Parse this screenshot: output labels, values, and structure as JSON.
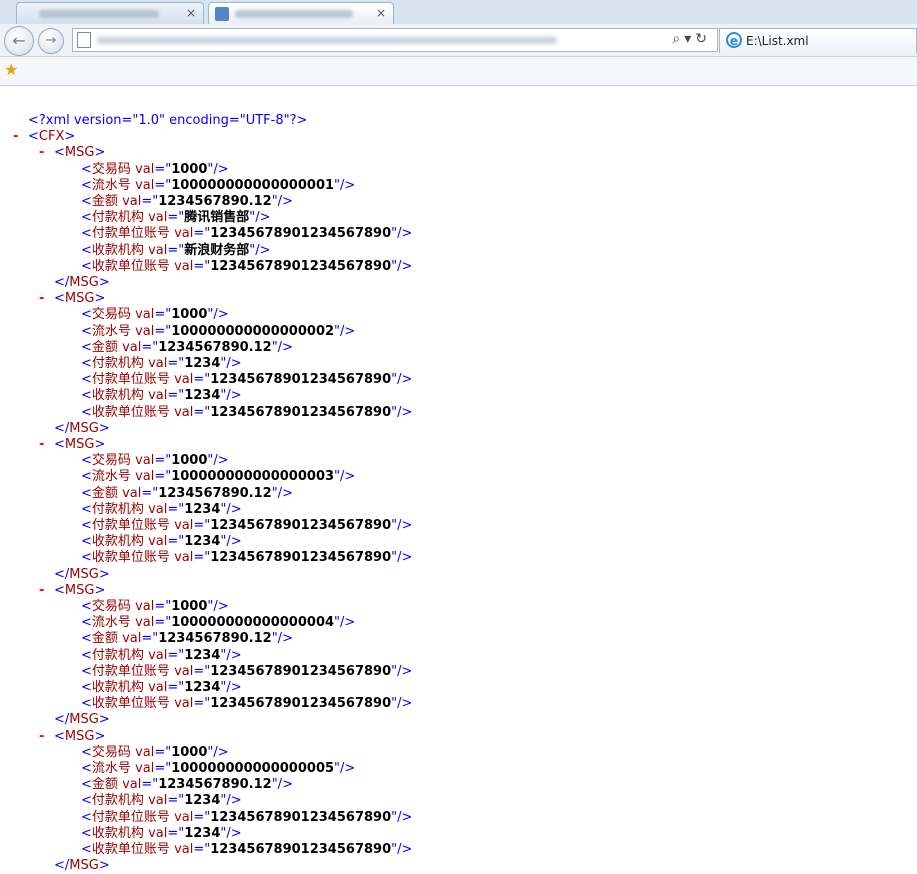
{
  "browser": {
    "io_tab_label": "E:\\List.xml",
    "back_glyph": "←",
    "forward_glyph": "→",
    "addr_tools": "⌕▾↻"
  },
  "xml": {
    "declaration": "<?xml version=\"1.0\" encoding=\"UTF-8\"?>",
    "collapse_glyph": "-",
    "root_tag": "CFX",
    "msg_tag": "MSG",
    "attr_name": "val",
    "messages": [
      {
        "fields": [
          {
            "name": "交易码",
            "value": "1000"
          },
          {
            "name": "流水号",
            "value": "100000000000000001"
          },
          {
            "name": "金额",
            "value": "1234567890.12"
          },
          {
            "name": "付款机构",
            "value": "腾讯销售部"
          },
          {
            "name": "付款单位账号",
            "value": "12345678901234567890"
          },
          {
            "name": "收款机构",
            "value": "新浪财务部"
          },
          {
            "name": "收款单位账号",
            "value": "12345678901234567890"
          }
        ]
      },
      {
        "fields": [
          {
            "name": "交易码",
            "value": "1000"
          },
          {
            "name": "流水号",
            "value": "100000000000000002"
          },
          {
            "name": "金额",
            "value": "1234567890.12"
          },
          {
            "name": "付款机构",
            "value": "1234"
          },
          {
            "name": "付款单位账号",
            "value": "12345678901234567890"
          },
          {
            "name": "收款机构",
            "value": "1234"
          },
          {
            "name": "收款单位账号",
            "value": "12345678901234567890"
          }
        ]
      },
      {
        "fields": [
          {
            "name": "交易码",
            "value": "1000"
          },
          {
            "name": "流水号",
            "value": "100000000000000003"
          },
          {
            "name": "金额",
            "value": "1234567890.12"
          },
          {
            "name": "付款机构",
            "value": "1234"
          },
          {
            "name": "付款单位账号",
            "value": "12345678901234567890"
          },
          {
            "name": "收款机构",
            "value": "1234"
          },
          {
            "name": "收款单位账号",
            "value": "12345678901234567890"
          }
        ]
      },
      {
        "fields": [
          {
            "name": "交易码",
            "value": "1000"
          },
          {
            "name": "流水号",
            "value": "100000000000000004"
          },
          {
            "name": "金额",
            "value": "1234567890.12"
          },
          {
            "name": "付款机构",
            "value": "1234"
          },
          {
            "name": "付款单位账号",
            "value": "12345678901234567890"
          },
          {
            "name": "收款机构",
            "value": "1234"
          },
          {
            "name": "收款单位账号",
            "value": "12345678901234567890"
          }
        ]
      },
      {
        "fields": [
          {
            "name": "交易码",
            "value": "1000"
          },
          {
            "name": "流水号",
            "value": "100000000000000005"
          },
          {
            "name": "金额",
            "value": "1234567890.12"
          },
          {
            "name": "付款机构",
            "value": "1234"
          },
          {
            "name": "付款单位账号",
            "value": "12345678901234567890"
          },
          {
            "name": "收款机构",
            "value": "1234"
          },
          {
            "name": "收款单位账号",
            "value": "12345678901234567890"
          }
        ]
      }
    ]
  }
}
